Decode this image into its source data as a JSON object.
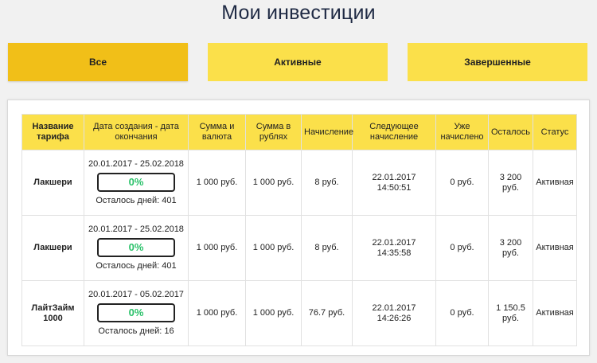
{
  "page": {
    "title": "Мои инвестиции"
  },
  "tabs": [
    {
      "label": "Все",
      "active": true
    },
    {
      "label": "Активные",
      "active": false
    },
    {
      "label": "Завершенные",
      "active": false
    }
  ],
  "colors": {
    "tab": "#fbe04a",
    "tab_active": "#f1bf18",
    "progress": "#2cc26b",
    "title": "#1f2a44"
  },
  "table": {
    "headers": [
      "Название тарифа",
      "Дата создания - дата окончания",
      "Сумма и валюта",
      "Сумма в рублях",
      "Начисление",
      "Следующее начисление",
      "Уже начислено",
      "Осталось",
      "Статус"
    ],
    "rows": [
      {
        "tariff": "Лакшери",
        "dates": "20.01.2017 - 25.02.2018",
        "progress": "0%",
        "progress_value": 0,
        "days_left": "Осталось дней: 401",
        "amount": "1 000 руб.",
        "amount_rub": "1 000 руб.",
        "accrual": "8 руб.",
        "next_date": "22.01.2017",
        "next_time": "14:50:51",
        "accrued": "0 руб.",
        "remaining": "3 200 руб.",
        "status": "Активная"
      },
      {
        "tariff": "Лакшери",
        "dates": "20.01.2017 - 25.02.2018",
        "progress": "0%",
        "progress_value": 0,
        "days_left": "Осталось дней: 401",
        "amount": "1 000 руб.",
        "amount_rub": "1 000 руб.",
        "accrual": "8 руб.",
        "next_date": "22.01.2017",
        "next_time": "14:35:58",
        "accrued": "0 руб.",
        "remaining": "3 200 руб.",
        "status": "Активная"
      },
      {
        "tariff": "ЛайтЗайм 1000",
        "dates": "20.01.2017 - 05.02.2017",
        "progress": "0%",
        "progress_value": 0,
        "days_left": "Осталось дней: 16",
        "amount": "1 000 руб.",
        "amount_rub": "1 000 руб.",
        "accrual": "76.7 руб.",
        "next_date": "22.01.2017",
        "next_time": "14:26:26",
        "accrued": "0 руб.",
        "remaining": "1 150.5 руб.",
        "status": "Активная"
      }
    ]
  }
}
